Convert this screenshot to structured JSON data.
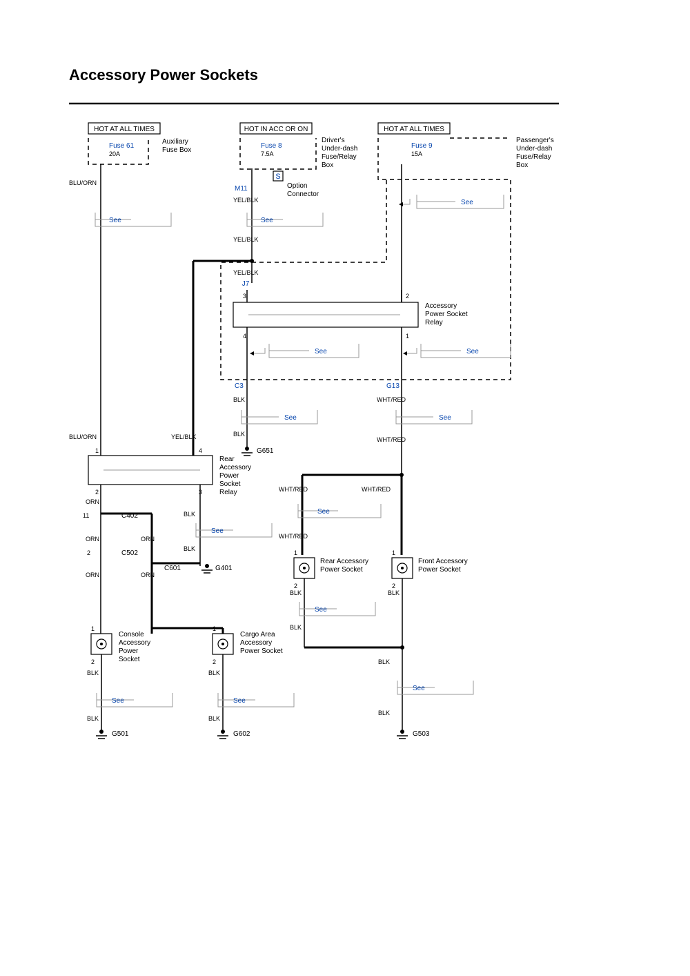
{
  "title": "Accessory Power Sockets",
  "headers": {
    "h1": "HOT AT ALL TIMES",
    "h2": "HOT IN ACC OR ON",
    "h3": "HOT AT ALL TIMES"
  },
  "fuses": {
    "f61": "Fuse 61",
    "f61a": "20A",
    "f8": "Fuse 8",
    "f8a": "7.5A",
    "f9": "Fuse 9",
    "f9a": "15A"
  },
  "boxes": {
    "aux1": "Auxiliary",
    "aux2": "Fuse Box",
    "drv1": "Driver's",
    "drv2": "Under-dash",
    "drv3": "Fuse/Relay",
    "drv4": "Box",
    "pas1": "Passenger's",
    "pas2": "Under-dash",
    "pas3": "Fuse/Relay",
    "pas4": "Box",
    "opt1": "Option",
    "opt2": "Connector",
    "aps1": "Accessory",
    "aps2": "Power Socket",
    "aps3": "Relay",
    "rear1": "Rear",
    "rear2": "Accessory",
    "rear3": "Power",
    "rear4": "Socket",
    "rear5": "Relay",
    "rearSock1": "Rear Accessory",
    "rearSock2": "Power Socket",
    "frontSock1": "Front Accessory",
    "frontSock2": "Power Socket",
    "cons1": "Console",
    "cons2": "Accessory",
    "cons3": "Power",
    "cons4": "Socket",
    "cargo1": "Cargo Area",
    "cargo2": "Accessory",
    "cargo3": "Power Socket"
  },
  "conn": {
    "S": "S",
    "M11": "M11",
    "J7": "J7",
    "C3": "C3",
    "G13": "G13",
    "C402": "C402",
    "C502": "C502",
    "C601": "C601",
    "G401": "G401",
    "G501": "G501",
    "G503": "G503",
    "G602": "G602",
    "G651": "G651"
  },
  "colors": {
    "BLUORN": "BLU/ORN",
    "YELBLK": "YEL/BLK",
    "ORN": "ORN",
    "BLK": "BLK",
    "WHTRED": "WHT/RED"
  },
  "see": "See",
  "pins": {
    "p1": "1",
    "p2": "2",
    "p3": "3",
    "p4": "4",
    "p11": "11"
  }
}
